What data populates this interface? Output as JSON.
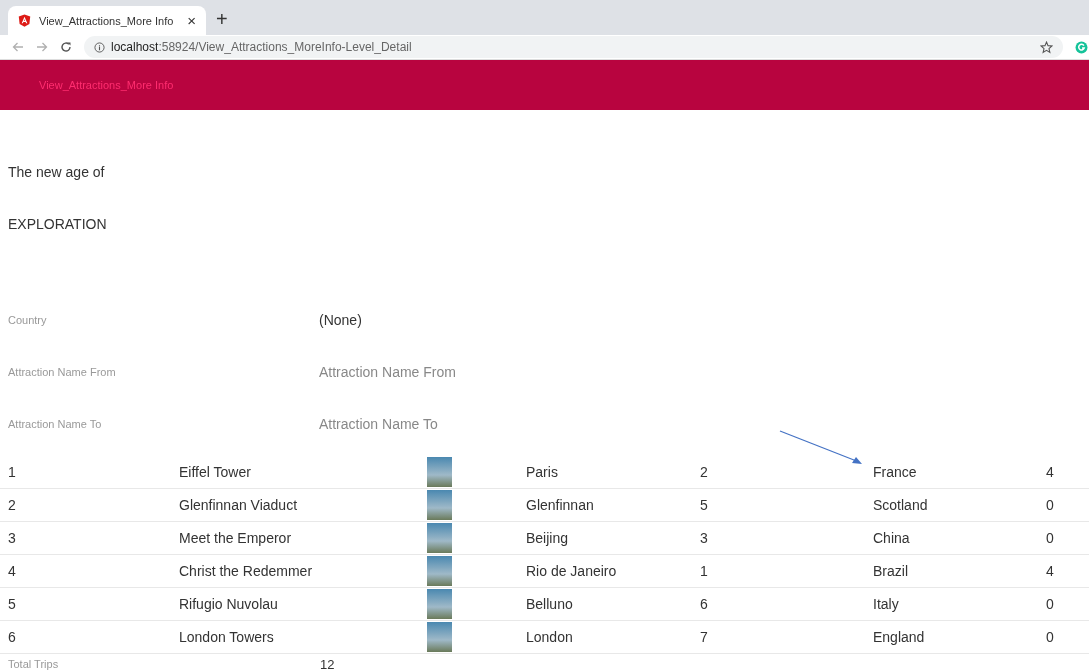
{
  "browser": {
    "tab_title": "View_Attractions_More Info",
    "new_tab": "+",
    "close": "×",
    "url_host": "localhost",
    "url_path": ":58924/View_Attractions_MoreInfo-Level_Detail"
  },
  "header": {
    "title": "View_Attractions_More Info"
  },
  "hero": {
    "line_1": "The new age of",
    "line_2": "EXPLORATION"
  },
  "filters": [
    {
      "kind": "select",
      "label": "Country",
      "value": "(None)"
    },
    {
      "kind": "input",
      "label": "Attraction Name From",
      "placeholder": "Attraction Name From"
    },
    {
      "kind": "input",
      "label": "Attraction Name To",
      "placeholder": "Attraction Name To"
    }
  ],
  "table": {
    "rows": [
      {
        "id": "1",
        "name": "Eiffel Tower",
        "city": "Paris",
        "column_5": "2",
        "country": "France",
        "column_7": "4"
      },
      {
        "id": "2",
        "name": "Glenfinnan Viaduct",
        "city": "Glenfinnan",
        "column_5": "5",
        "country": "Scotland",
        "column_7": "0"
      },
      {
        "id": "3",
        "name": "Meet the Emperor",
        "city": "Beijing",
        "column_5": "3",
        "country": "China",
        "column_7": "0"
      },
      {
        "id": "4",
        "name": "Christ the Redemmer",
        "city": "Rio de Janeiro",
        "column_5": "1",
        "country": "Brazil",
        "column_7": "4"
      },
      {
        "id": "5",
        "name": "Rifugio Nuvolau",
        "city": "Belluno",
        "column_5": "6",
        "country": "Italy",
        "column_7": "0"
      },
      {
        "id": "6",
        "name": "London Towers",
        "city": "London",
        "column_5": "7",
        "country": "England",
        "column_7": "0"
      }
    ]
  },
  "total": {
    "label": "Total Trips",
    "value": "12"
  }
}
